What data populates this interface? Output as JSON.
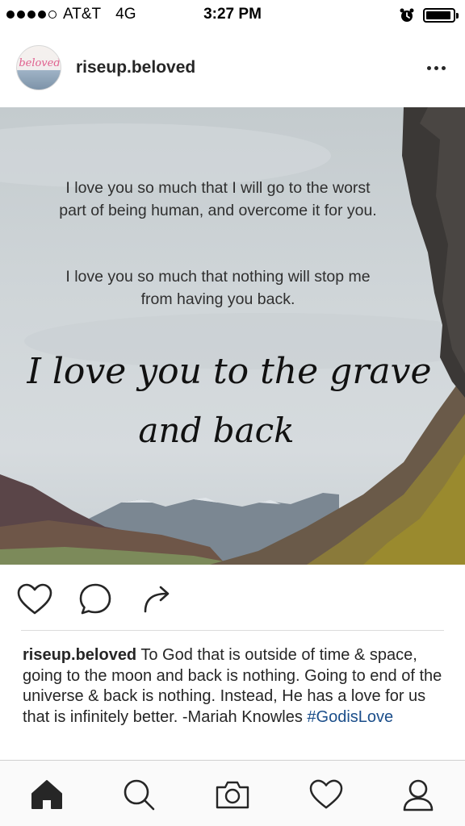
{
  "status_bar": {
    "carrier": "AT&T",
    "network": "4G",
    "time": "3:27 PM",
    "signal_bars_filled": 4,
    "signal_bars_total": 5,
    "alarm_icon": "alarm-clock-icon",
    "battery_level": 0.95
  },
  "post": {
    "avatar_text": "beloved",
    "username": "riseup.beloved",
    "more_icon": "more-horizontal-icon",
    "image": {
      "quote_1_line_1": "I love you so much that I will go to the worst",
      "quote_1_line_2": "part of being human, and overcome it for you.",
      "quote_2_line_1": "I love you so much that nothing will stop me",
      "quote_2_line_2": "from having you back.",
      "script_line_1": "I love you to the grave",
      "script_line_2": "and back"
    },
    "actions": {
      "like_icon": "heart-icon",
      "comment_icon": "comment-icon",
      "share_icon": "share-arrow-icon"
    },
    "caption": {
      "username": "riseup.beloved",
      "text": " To God that is outside of time & space, going to the moon and back is nothing. Going to end of the universe & back is nothing. Instead, He has a love for us that is infinitely better. -Mariah Knowles ",
      "hashtag": "#GodisLove"
    }
  },
  "tab_bar": {
    "items": [
      "home-icon",
      "search-icon",
      "camera-icon",
      "heart-icon",
      "profile-icon"
    ],
    "active": "home-icon"
  },
  "colors": {
    "hashtag": "#1b4e8a",
    "text": "#262626",
    "avatar_pink": "#e0608f"
  }
}
